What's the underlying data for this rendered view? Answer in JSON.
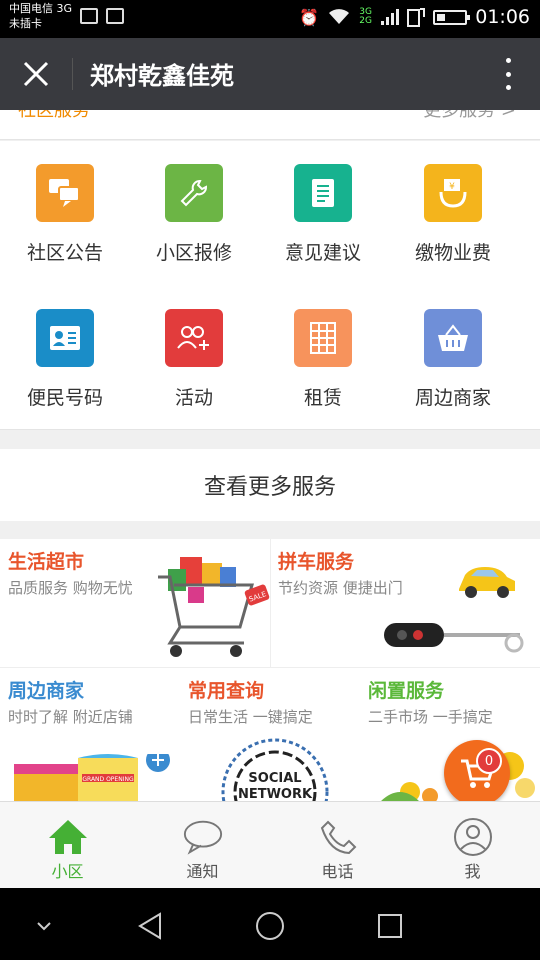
{
  "status_bar": {
    "carrier_line1": "中国电信 3G",
    "carrier_line2": "未插卡",
    "network_badge": "3G 2G",
    "time": "01:06"
  },
  "app_bar": {
    "title": "郑村乾鑫佳苑"
  },
  "scroll_header": {
    "left_label": "社区服务",
    "right_label": "更多服务 >"
  },
  "services": [
    {
      "label": "社区公告",
      "icon": "chat-bubbles-icon",
      "color": "#f39b2c"
    },
    {
      "label": "小区报修",
      "icon": "wrench-icon",
      "color": "#6cb545"
    },
    {
      "label": "意见建议",
      "icon": "document-icon",
      "color": "#17b28f"
    },
    {
      "label": "缴物业费",
      "icon": "payment-icon",
      "color": "#f4b41c"
    },
    {
      "label": "便民号码",
      "icon": "contact-card-icon",
      "color": "#1a8dc8"
    },
    {
      "label": "活动",
      "icon": "people-icon",
      "color": "#e23c3c"
    },
    {
      "label": "租赁",
      "icon": "building-icon",
      "color": "#f7935c"
    },
    {
      "label": "周边商家",
      "icon": "shop-basket-icon",
      "color": "#6f8fd8"
    }
  ],
  "more_services": "查看更多服务",
  "banners": [
    {
      "title": "生活超市",
      "subtitle": "品质服务 购物无忧",
      "color": "#e8552c"
    },
    {
      "title": "拼车服务",
      "subtitle": "节约资源 便捷出门",
      "color": "#e8552c"
    },
    {
      "title": "周边商家",
      "subtitle": "时时了解 附近店铺",
      "color": "#3a8bd0"
    },
    {
      "title": "常用查询",
      "subtitle": "日常生活 一键搞定",
      "color": "#e8552c"
    },
    {
      "title": "闲置服务",
      "subtitle": "二手市场 一手搞定",
      "color": "#5bb83a"
    }
  ],
  "banner_art_text": {
    "social": "SOCIAL",
    "network": "NETWORK",
    "grand_opening": "GRAND OPENING",
    "sale": "SALE"
  },
  "cart_badge": "0",
  "tabs": [
    {
      "label": "小区",
      "icon": "home-icon",
      "active": true
    },
    {
      "label": "通知",
      "icon": "chat-icon",
      "active": false
    },
    {
      "label": "电话",
      "icon": "phone-icon",
      "active": false
    },
    {
      "label": "我",
      "icon": "user-icon",
      "active": false
    }
  ],
  "colors": {
    "accent_green": "#45b035",
    "appbar": "#393a3f"
  }
}
